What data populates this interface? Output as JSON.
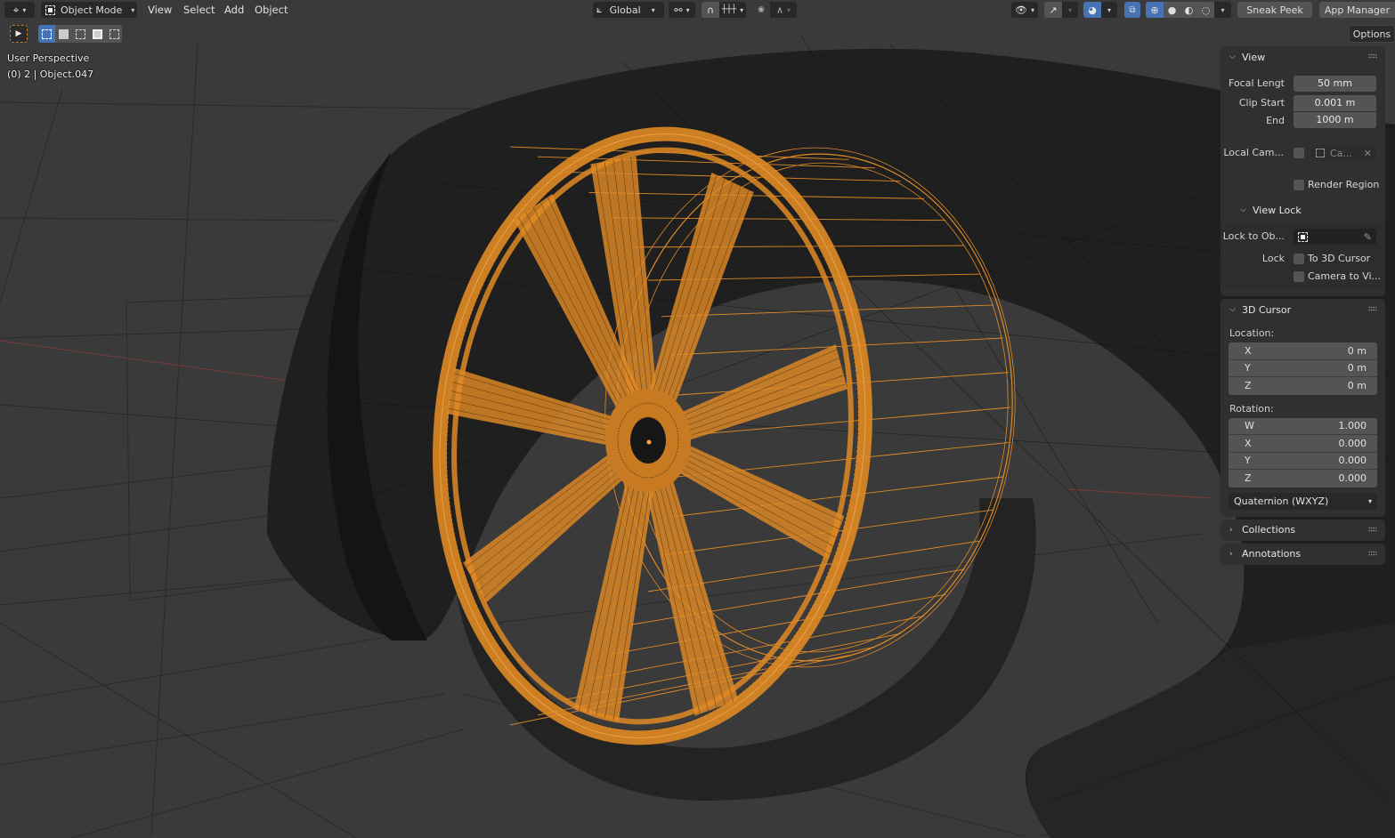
{
  "header": {
    "editor_type_icon": "3d-viewport-icon",
    "mode": "Object Mode",
    "menus": [
      "View",
      "Select",
      "Add",
      "Object"
    ],
    "transform_orientation": "Global",
    "buttons": {
      "sneak_peek": "Sneak Peek",
      "app_manager": "App Manager",
      "options": "Options"
    }
  },
  "viewport": {
    "perspective_label": "User Perspective",
    "object_label": "(0) 2 | Object.047",
    "shading_mode": "wireframe",
    "selection_color": "#e08a25",
    "wire_color": "#151515",
    "background_color": "#3a3a3a"
  },
  "sidebar": {
    "view": {
      "title": "View",
      "focal_length_label": "Focal Lengt",
      "focal_length_value": "50 mm",
      "clip_start_label": "Clip Start",
      "clip_start_value": "0.001 m",
      "clip_end_label": "End",
      "clip_end_value": "1000 m",
      "local_camera_label": "Local Cam...",
      "local_camera_value": "Ca...",
      "render_region_label": "Render Region",
      "view_lock": {
        "title": "View Lock",
        "lock_to_object_label": "Lock to Ob...",
        "lock_label": "Lock",
        "to_3d_cursor_label": "To 3D Cursor",
        "camera_to_view_label": "Camera to Vi..."
      }
    },
    "cursor": {
      "title": "3D Cursor",
      "location_label": "Location:",
      "location": [
        {
          "axis": "X",
          "value": "0 m"
        },
        {
          "axis": "Y",
          "value": "0 m"
        },
        {
          "axis": "Z",
          "value": "0 m"
        }
      ],
      "rotation_label": "Rotation:",
      "rotation": [
        {
          "axis": "W",
          "value": "1.000"
        },
        {
          "axis": "X",
          "value": "0.000"
        },
        {
          "axis": "Y",
          "value": "0.000"
        },
        {
          "axis": "Z",
          "value": "0.000"
        }
      ],
      "rotation_mode": "Quaternion (WXYZ)"
    },
    "collections": {
      "title": "Collections"
    },
    "annotations": {
      "title": "Annotations"
    }
  }
}
